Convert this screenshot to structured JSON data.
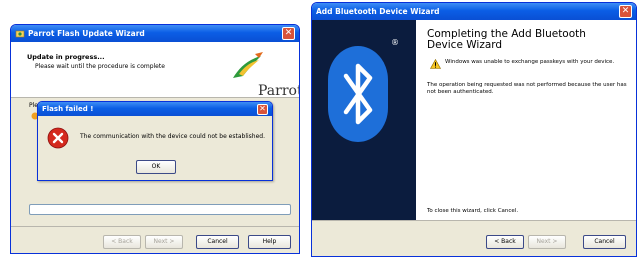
{
  "parrot_wizard": {
    "title": "Parrot Flash Update Wizard",
    "header_title": "Update in progress...",
    "header_subtitle": "Please wait until the procedure is complete",
    "logo_text": "Parrot",
    "body_text": "Ple",
    "progress_percent": 0,
    "buttons": {
      "back": "< Back",
      "next": "Next >",
      "cancel": "Cancel",
      "help": "Help"
    }
  },
  "flash_dialog": {
    "title": "Flash failed !",
    "message": "The communication with the device could not be established.",
    "ok_label": "OK"
  },
  "bluetooth_wizard": {
    "title": "Add Bluetooth Device Wizard",
    "registered_mark": "®",
    "heading_line1": "Completing the Add Bluetooth",
    "heading_line2": "Device Wizard",
    "warning_text": "Windows was unable to exchange passkeys with your device.",
    "info_text": "The operation being requested was not performed because the user has not been authenticated.",
    "close_hint": "To close this wizard, click Cancel.",
    "buttons": {
      "back": "< Back",
      "next": "Next >",
      "cancel": "Cancel"
    }
  },
  "colors": {
    "xp_title_blue": "#0b5ee5",
    "xp_face": "#ece9d8",
    "close_red": "#d9533a",
    "bluetooth_panel": "#0b1c3e",
    "bluetooth_blue": "#1e6fd9"
  },
  "icons": [
    "wizard-icon",
    "parrot-logo-icon",
    "warning-icon",
    "error-icon",
    "bluetooth-logo-icon",
    "close-icon"
  ]
}
